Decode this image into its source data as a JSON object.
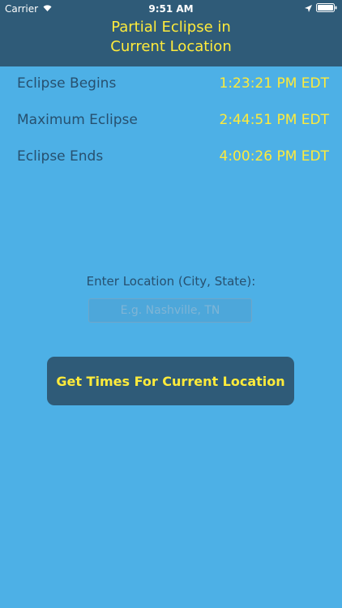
{
  "status_bar": {
    "carrier": "Carrier",
    "time": "9:51 AM"
  },
  "header": {
    "title_line1": "Partial Eclipse in",
    "title_line2": "Current Location"
  },
  "eclipse_times": [
    {
      "label": "Eclipse Begins",
      "value": "1:23:21 PM EDT"
    },
    {
      "label": "Maximum Eclipse",
      "value": "2:44:51 PM EDT"
    },
    {
      "label": "Eclipse Ends",
      "value": "4:00:26 PM EDT"
    }
  ],
  "location": {
    "label": "Enter Location (City, State):",
    "placeholder": "E.g. Nashville, TN",
    "value": ""
  },
  "buttons": {
    "get_times": "Get Times For Current Location"
  },
  "colors": {
    "background": "#4db0e6",
    "header": "#2f5b78",
    "accent_text": "#ffeb3b",
    "label_text": "#27506f"
  }
}
